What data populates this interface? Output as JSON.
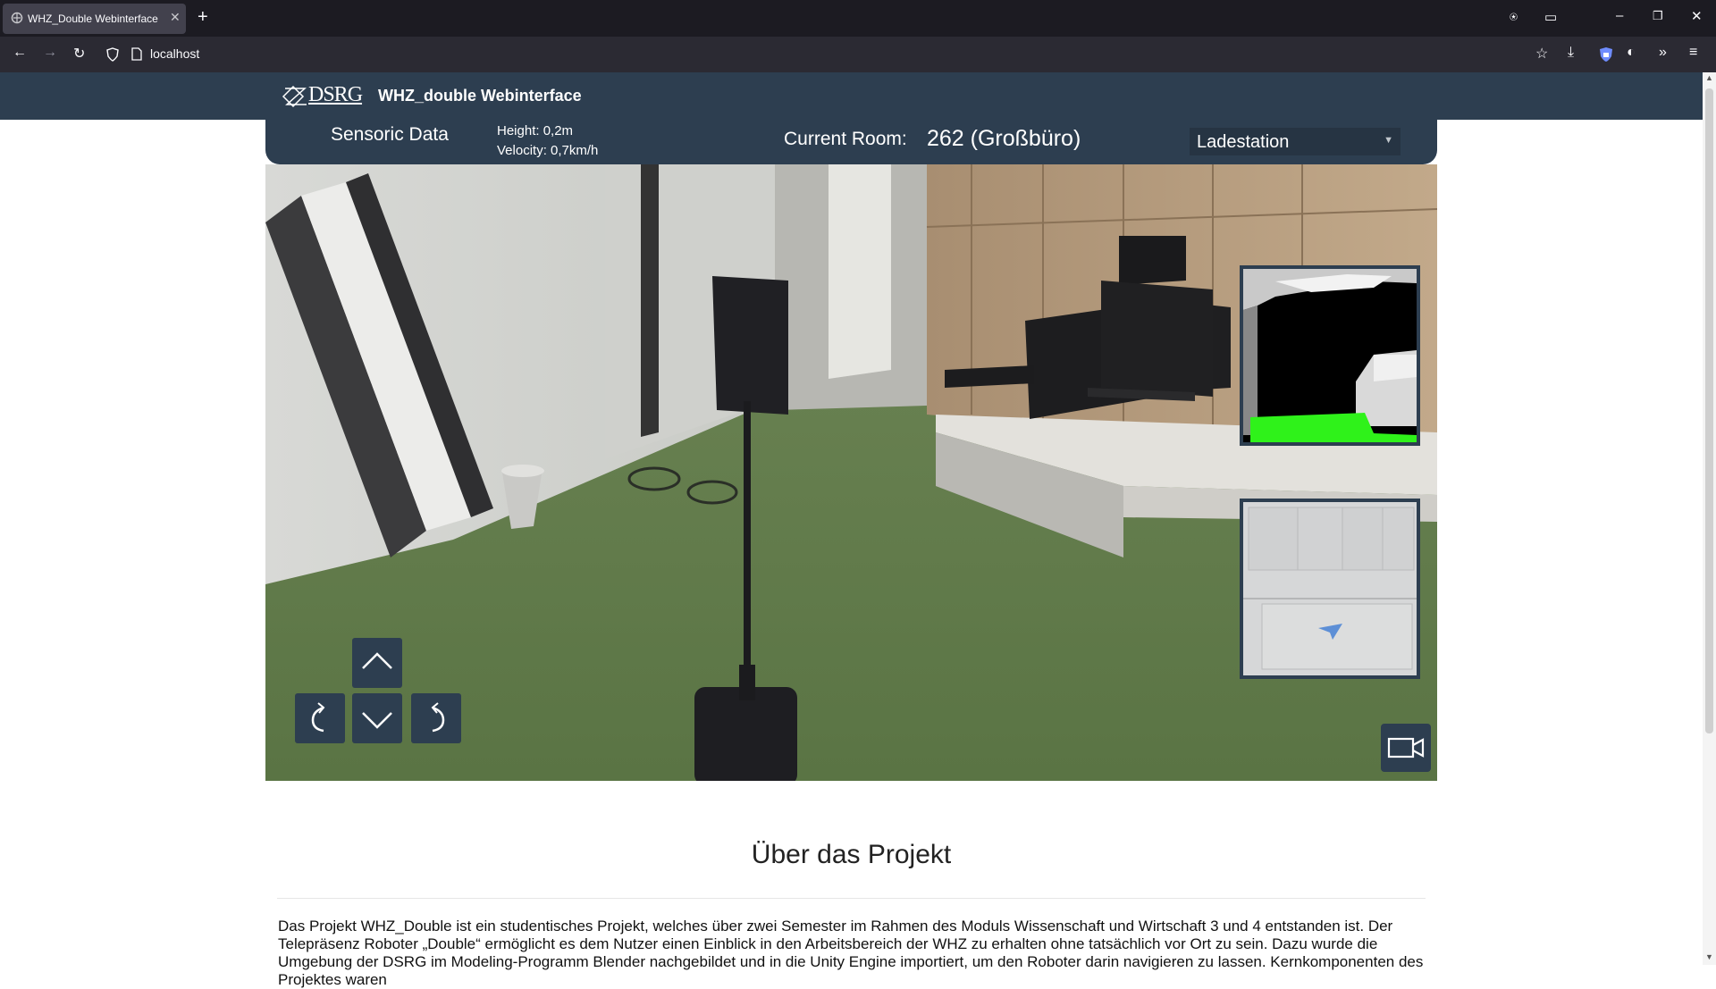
{
  "browser": {
    "tab_title": "WHZ_Double Webinterface",
    "url": "localhost"
  },
  "header": {
    "logo_text": "DSRG",
    "title": "WHZ_double Webinterface"
  },
  "panel": {
    "sensoric_label": "Sensoric Data",
    "height": "Height: 0,2m",
    "velocity": "Velocity: 0,7km/h",
    "room_label": "Current Room:",
    "room_value": "262 (Großbüro)",
    "destination": "Ladestation"
  },
  "controls": {
    "forward_icon": "chevron-up",
    "back_icon": "chevron-down",
    "rotate_left_icon": "rotate-left",
    "rotate_right_icon": "rotate-right",
    "camera_icon": "video-camera"
  },
  "about": {
    "title": "Über das Projekt",
    "text": "Das Projekt WHZ_Double ist ein studentisches Projekt, welches über zwei Semester im Rahmen des Moduls Wissenschaft und Wirtschaft 3 und 4 entstanden ist. Der Telepräsenz Roboter „Double“ ermöglicht es dem Nutzer einen Einblick in den Arbeitsbereich der WHZ zu erhalten ohne tatsächlich vor Ort zu sein. Dazu wurde die Umgebung der DSRG im Modeling-Programm Blender nachgebildet und in die Unity Engine importiert, um den Roboter darin navigieren zu lassen. Kernkomponenten des Projektes waren"
  },
  "colors": {
    "header_bg": "#2d3e50",
    "depth_green": "#2ff21a"
  }
}
